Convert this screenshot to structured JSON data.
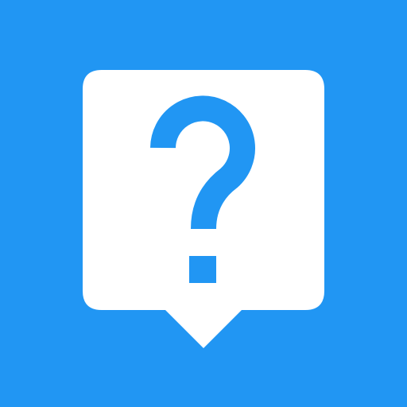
{
  "colors": {
    "background": "#2196F3",
    "bubble": "#FFFFFF",
    "glyph": "#2196F3"
  },
  "icon": {
    "name": "help-speech-bubble-icon",
    "bubble": "speech-bubble-icon",
    "symbol": "question-mark-icon"
  }
}
